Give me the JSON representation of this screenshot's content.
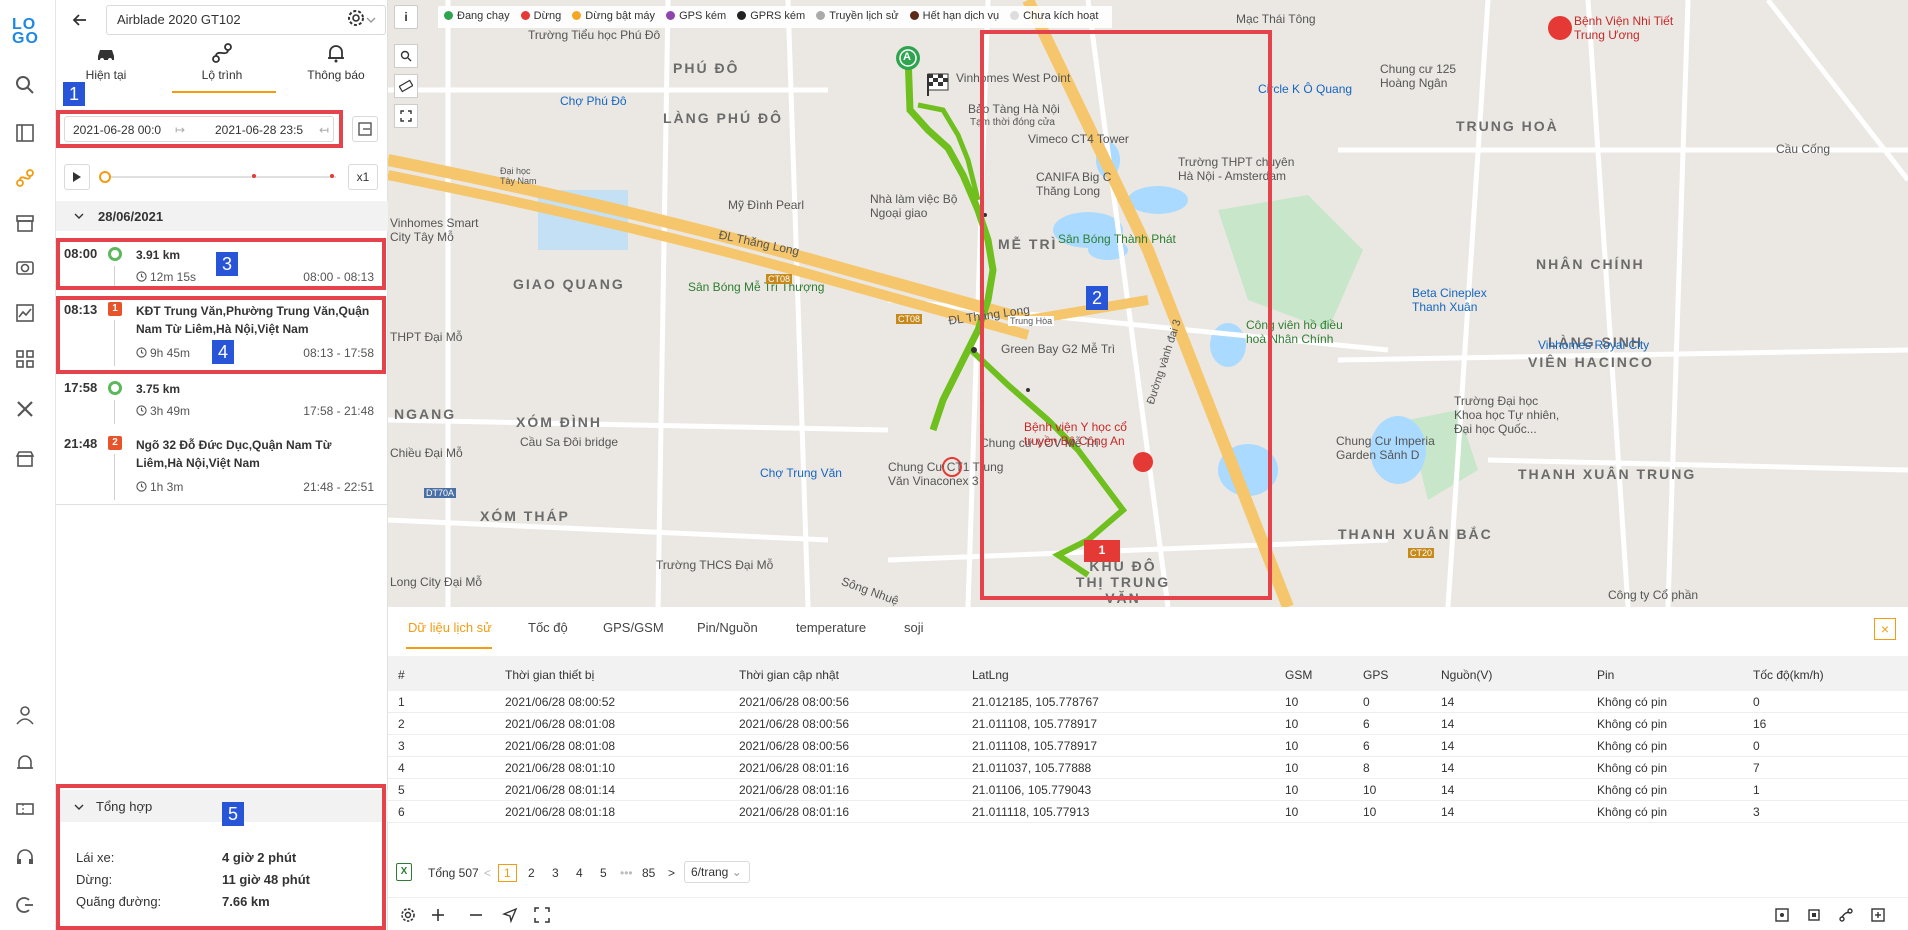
{
  "panel": {
    "device": "Airblade 2020 GT102",
    "tabs": [
      {
        "label": "Hiện tại"
      },
      {
        "label": "Lộ trình"
      },
      {
        "label": "Thông báo"
      }
    ],
    "date_from": "2021-06-28 00:0",
    "date_to": "2021-06-28 23:5",
    "speed": "x1",
    "day": "28/06/2021",
    "trips": [
      {
        "time": "08:00",
        "marker": "",
        "title": "3.91 km",
        "duration": "12m 15s",
        "range": "08:00 - 08:13"
      },
      {
        "time": "08:13",
        "marker": "1",
        "title": "KĐT Trung Văn,Phường Trung Văn,Quận Nam Từ Liêm,Hà Nội,Việt Nam",
        "duration": "9h 45m",
        "range": "08:13 - 17:58"
      },
      {
        "time": "17:58",
        "marker": "",
        "title": "3.75 km",
        "duration": "3h 49m",
        "range": "17:58 - 21:48"
      },
      {
        "time": "21:48",
        "marker": "2",
        "title": "Ngõ 32 Đỗ Đức Dục,Quận Nam Từ Liêm,Hà Nội,Việt Nam",
        "duration": "1h 3m",
        "range": "21:48 - 22:51"
      }
    ],
    "summary": {
      "title": "Tổng hợp",
      "rows": [
        {
          "label": "Lái xe:",
          "value": "4 giờ 2 phút"
        },
        {
          "label": "Dừng:",
          "value": "11 giờ 48 phút"
        },
        {
          "label": "Quãng đường:",
          "value": "7.66 km"
        }
      ]
    }
  },
  "map": {
    "legend": [
      {
        "label": "Đang chạy",
        "color": "#2ea44f"
      },
      {
        "label": "Dừng",
        "color": "#e53935"
      },
      {
        "label": "Dừng bật máy",
        "color": "#f5a623"
      },
      {
        "label": "GPS kém",
        "color": "#8e44ad"
      },
      {
        "label": "GPRS kém",
        "color": "#222222"
      },
      {
        "label": "Truyền lịch sử",
        "color": "#aaaaaa"
      },
      {
        "label": "Hết hạn dịch vụ",
        "color": "#5d2a1a"
      },
      {
        "label": "Chưa kích hoạt",
        "color": "#dddddd"
      }
    ],
    "info_label": "i",
    "labels": {
      "phu_do": "PHÚ ĐÔ",
      "lang_phu_do": "LÀNG PHÚ ĐÔ",
      "me_tri": "MỄ TRÌ",
      "giao_quang": "GIAO QUANG",
      "xom_dinh": "XÓM ĐÌNH",
      "xom_thap": "XÓM THÁP",
      "trung_hoa": "TRUNG HOÀ",
      "nhan_chinh": "NHÂN CHÍNH",
      "lang_sinh": "LÀNG SINH",
      "vien_hacinco": "VIÊN HACINCO",
      "thanh_xuan_trung": "THANH XUÂN TRUNG",
      "thanh_xuan_bac": "THANH XUÂN BẮC",
      "khu_do_thi": "KHU ĐÔ THỊ TRUNG VĂN",
      "ngang": "NGANG",
      "vinhomes_west": "Vinhomes West Point",
      "bao_tang": "Bảo Tàng Hà Nội",
      "bao_tang_sub": "Tạm thời đóng cửa",
      "my_dinh_pearl": "Mỹ Đình Pearl",
      "nha_lam_viec": "Nhà làm việc Bộ Ngoại giao",
      "vinhomes_smart": "Vinhomes Smart City Tây Mỗ",
      "cho_phu_do": "Chợ Phú Đô",
      "san_bong_me_tri": "Sân Bóng Mễ Trì Thượng",
      "green_bay": "Green Bay G2 Mễ Trì",
      "chung_cu_vov": "Chung cư VOV Mễ Trì",
      "cho_trung_van": "Chợ Trung Văn",
      "chung_cu_ct1": "Chung Cư CT1 Trung Văn Vinaconex 3",
      "cau_sa_doi": "Cầu Sa Đôi bridge",
      "thcs_dai_mo": "Trường THCS Đại Mỗ",
      "long_city": "Long City Đại Mỗ",
      "thpt_dai_mo": "THPT Đại Mỗ",
      "chieu_dai_mo": "Chiều Đại Mỗ",
      "vimeco": "Vimeco CT4 Tower",
      "canifa": "CANIFA Big C Thăng Long",
      "thpt_amsterdam": "Trường THPT chuyên Hà Nội - Amsterdam",
      "circle_k": "Circle K Ô Quang",
      "san_bong_thanh_phat": "Sân Bóng Thành Phát",
      "cong_vien": "Công viên hồ điều hoà Nhân Chính",
      "beta": "Beta Cineplex Thanh Xuân",
      "vinhomes_royal": "Vinhomes Royal City",
      "benh_vien_y_hoc": "Bệnh viện Y học cổ truyền Bộ Công An",
      "benh_vien_nhi": "Bệnh Viện Nhi Tiết Trung Ương",
      "chung_cu_125": "Chung cư 125 Hoàng Ngân",
      "chung_cu_imperia": "Chung Cư Imperia Garden Sảnh D",
      "truong_dai_hoc": "Trường Đại học Khoa học Tự nhiên, Đại học Quốc...",
      "mac_thai_tong": "Mạc Thái Tông",
      "tieu_hoc_phu_do": "Trường Tiểu học Phú Đô",
      "dl_thang_long": "ĐL Thăng Long",
      "dai_hoc_tay_nam": "Đại học Tây Nam",
      "duong_vanh_dai_3": "Đường vành đai 3",
      "cong_ty": "Công ty Cổ phần",
      "cau_coong": "Cầu Cống",
      "song_nhue": "Sông Nhuệ",
      "dt70a": "DT70A",
      "ct08": "CT08",
      "ct20": "CT20",
      "trung_hoa_road": "Trung Hòa",
      "marker_1": "1",
      "flag_a": "A"
    }
  },
  "data_panel": {
    "tabs": [
      "Dữ liệu lịch sử",
      "Tốc độ",
      "GPS/GSM",
      "Pin/Nguồn",
      "temperature",
      "soji"
    ],
    "close_label": "×",
    "columns": [
      "#",
      "Thời gian thiết bị",
      "Thời gian cập nhật",
      "LatLng",
      "GSM",
      "GPS",
      "Nguồn(V)",
      "Pin",
      "Tốc độ(km/h)"
    ],
    "rows": [
      [
        "1",
        "2021/06/28 08:00:52",
        "2021/06/28 08:00:56",
        "21.012185, 105.778767",
        "10",
        "0",
        "14",
        "Không có pin",
        "0"
      ],
      [
        "2",
        "2021/06/28 08:01:08",
        "2021/06/28 08:00:56",
        "21.011108, 105.778917",
        "10",
        "6",
        "14",
        "Không có pin",
        "16"
      ],
      [
        "3",
        "2021/06/28 08:01:08",
        "2021/06/28 08:00:56",
        "21.011108, 105.778917",
        "10",
        "6",
        "14",
        "Không có pin",
        "0"
      ],
      [
        "4",
        "2021/06/28 08:01:10",
        "2021/06/28 08:01:16",
        "21.011037, 105.77888",
        "10",
        "8",
        "14",
        "Không có pin",
        "7"
      ],
      [
        "5",
        "2021/06/28 08:01:14",
        "2021/06/28 08:01:16",
        "21.01106, 105.779043",
        "10",
        "10",
        "14",
        "Không có pin",
        "1"
      ],
      [
        "6",
        "2021/06/28 08:01:18",
        "2021/06/28 08:01:16",
        "21.011118, 105.77913",
        "10",
        "10",
        "14",
        "Không có pin",
        "3"
      ]
    ],
    "pager": {
      "excel": "X",
      "total": "Tổng 507",
      "prev": "<",
      "pages": [
        "1",
        "2",
        "3",
        "4",
        "5"
      ],
      "ellipsis": "•••",
      "last": "85",
      "next": ">",
      "per_page": "6/trang"
    }
  },
  "annotations": [
    "1",
    "2",
    "3",
    "4",
    "5"
  ]
}
